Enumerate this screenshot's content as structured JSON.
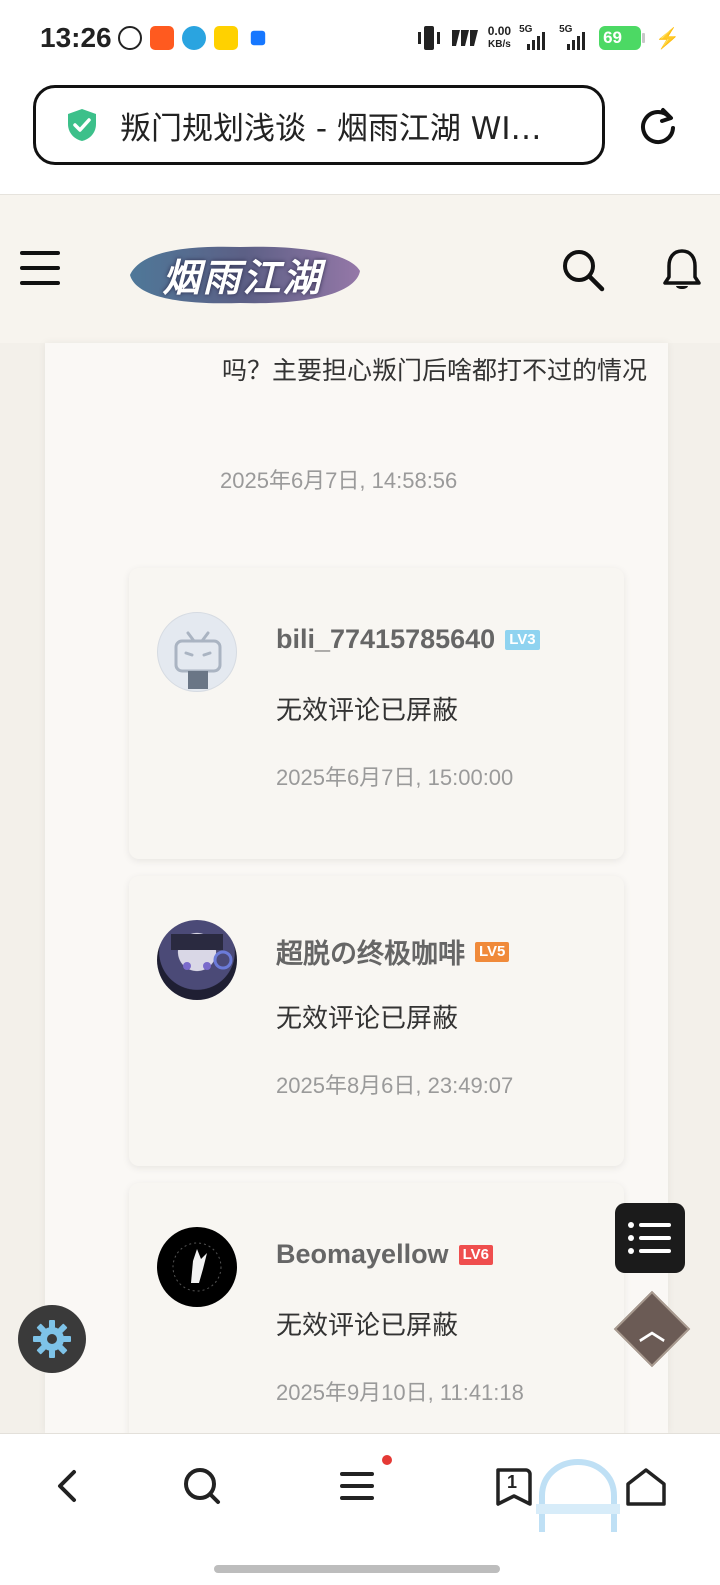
{
  "status_bar": {
    "time": "13:26",
    "net_speed_value": "0.00",
    "net_speed_unit": "KB/s",
    "signal1_label": "5G",
    "signal2_label": "5G",
    "battery": "69"
  },
  "browser": {
    "tab_title": "叛门规划浅谈 - 烟雨江湖 WI…"
  },
  "site": {
    "logo_text": "烟雨江湖"
  },
  "previous_comment": {
    "text": "吗？主要担心叛门后啥都打不过的情况",
    "time": "2025年6月7日, 14:58:56"
  },
  "comments": [
    {
      "username": "bili_77415785640",
      "level": "LV3",
      "level_color": "#8fd3f0",
      "text": "无效评论已屏蔽",
      "time": "2025年6月7日, 15:00:00"
    },
    {
      "username": "超脱の终极咖啡",
      "level": "LV5",
      "level_color": "#f08a3a",
      "text": "无效评论已屏蔽",
      "time": "2025年8月6日, 23:49:07"
    },
    {
      "username": "Beomayellow",
      "level": "LV6",
      "level_color": "#ef4e4e",
      "text": "无效评论已屏蔽",
      "time": "2025年9月10日, 11:41:18"
    }
  ],
  "bottom_nav": {
    "tabs_count": "1"
  }
}
